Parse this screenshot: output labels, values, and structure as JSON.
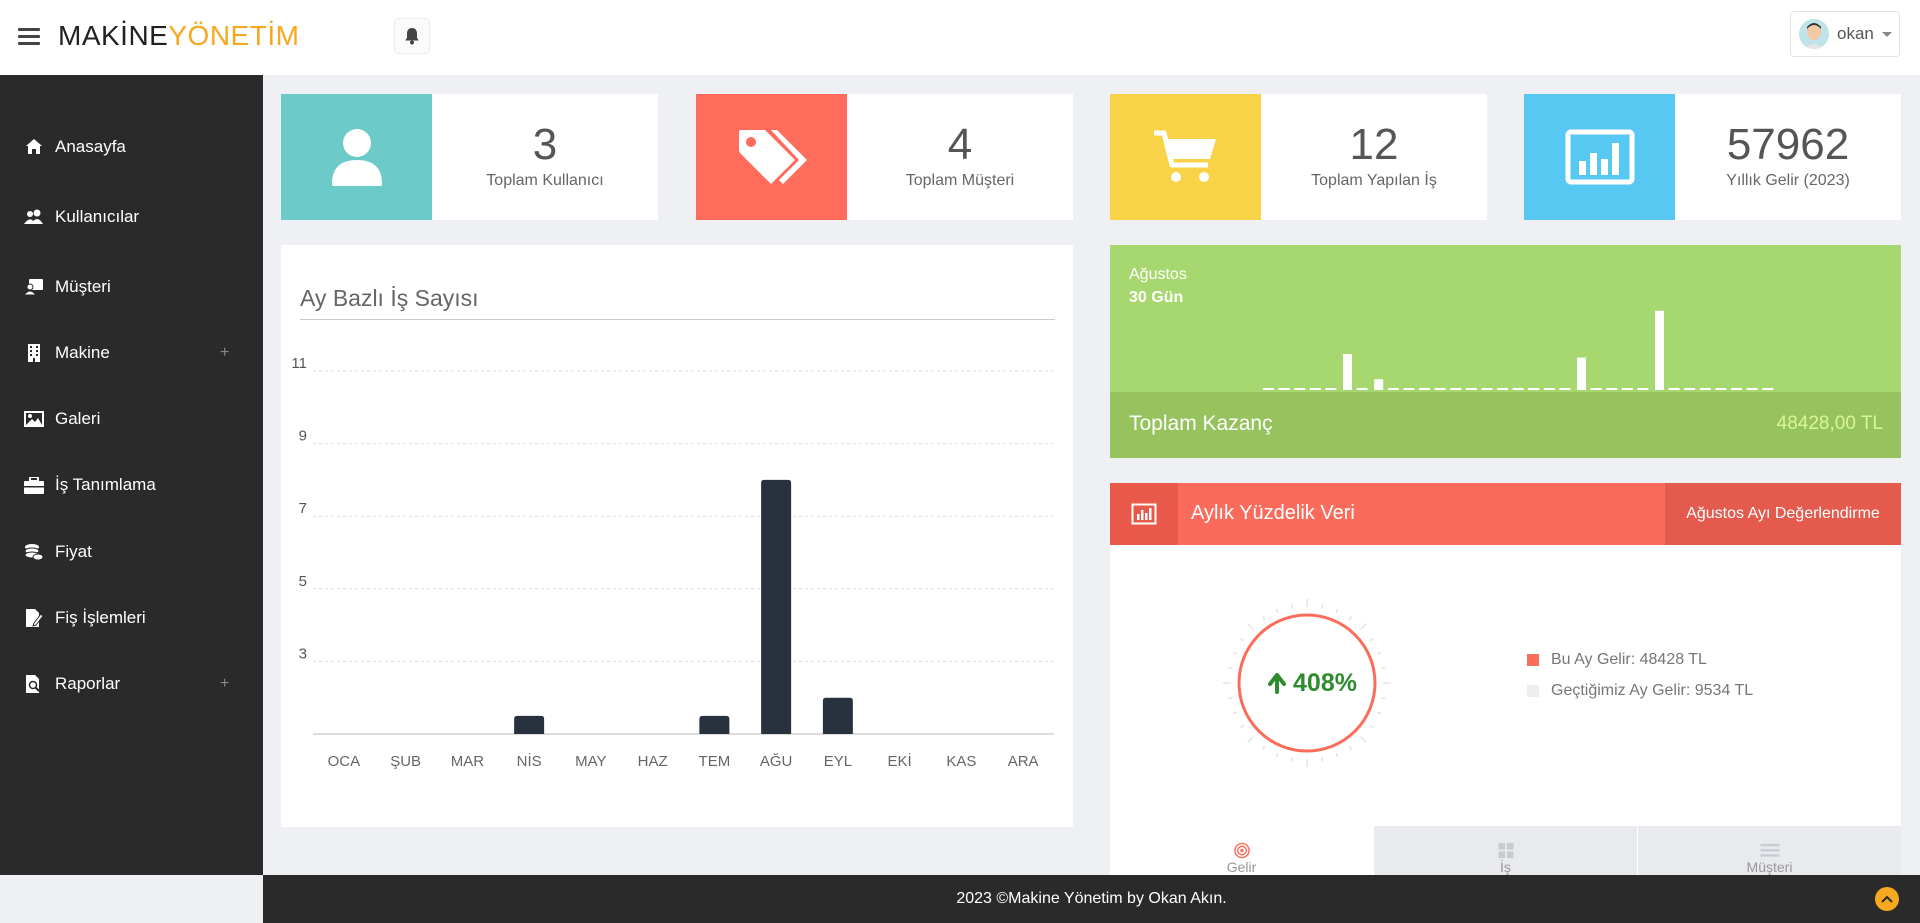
{
  "header": {
    "logo_part1": "MAKİNE",
    "logo_part2": "YÖNETİM",
    "user_name": "okan"
  },
  "sidebar": {
    "items": [
      {
        "label": "Anasayfa",
        "icon": "home-icon"
      },
      {
        "label": "Kullanıcılar",
        "icon": "users-icon"
      },
      {
        "label": "Müşteri",
        "icon": "customer-card-icon"
      },
      {
        "label": "Makine",
        "icon": "building-icon",
        "expandable": true
      },
      {
        "label": "Galeri",
        "icon": "image-icon"
      },
      {
        "label": "İş Tanımlama",
        "icon": "briefcase-icon"
      },
      {
        "label": "Fiyat",
        "icon": "coins-icon"
      },
      {
        "label": "Fiş İşlemleri",
        "icon": "edit-file-icon"
      },
      {
        "label": "Raporlar",
        "icon": "search-file-icon",
        "expandable": true
      }
    ],
    "expand_symbol": "+"
  },
  "stats": [
    {
      "value": "3",
      "caption": "Toplam Kullanıcı",
      "color": "#6ccac9",
      "icon": "user-icon"
    },
    {
      "value": "4",
      "caption": "Toplam Müşteri",
      "color": "#ff6c5c",
      "icon": "tags-icon"
    },
    {
      "value": "12",
      "caption": "Toplam Yapılan İş",
      "color": "#f8d347",
      "icon": "cart-icon"
    },
    {
      "value": "57962",
      "caption": "Yıllık Gelir (2023)",
      "color": "#57c8f2",
      "icon": "bar-chart-icon"
    }
  ],
  "chart_panel": {
    "title": "Ay Bazlı İş Sayısı"
  },
  "chart_data": {
    "type": "bar",
    "categories": [
      "OCA",
      "ŞUB",
      "MAR",
      "NİS",
      "MAY",
      "HAZ",
      "TEM",
      "AĞU",
      "EYL",
      "EKİ",
      "KAS",
      "ARA"
    ],
    "values": [
      0,
      0,
      0,
      0.5,
      0,
      0,
      0.5,
      7,
      1,
      0,
      0,
      0
    ],
    "y_ticks": [
      3,
      5,
      7,
      9,
      11
    ],
    "ylim": [
      1,
      11
    ],
    "grid": true,
    "bar_color": "#28323e"
  },
  "green_panel": {
    "month": "Ağustos",
    "days": "30 Gün",
    "total_label": "Toplam Kazanç",
    "total_value": "48428,00 TL",
    "daily_values": [
      0,
      0,
      0,
      0,
      0,
      5,
      0,
      1.5,
      0,
      0,
      0,
      0,
      0,
      0,
      0,
      0,
      0,
      0,
      0,
      0,
      4.5,
      0,
      0,
      0,
      0,
      11,
      0,
      0,
      0,
      0,
      0,
      0,
      0
    ]
  },
  "percent_panel": {
    "title": "Aylık Yüzdelik Veri",
    "button_label": "Ağustos Ayı Değerlendirme",
    "gauge_value": "408%",
    "legend": [
      {
        "label": "Bu Ay Gelir: 48428 TL",
        "color": "#fa6d5a"
      },
      {
        "label": "Geçtiğimiz Ay Gelir: 9534 TL",
        "color": "#eeeeee"
      }
    ],
    "tabs": [
      {
        "label": "Gelir",
        "icon": "target-icon"
      },
      {
        "label": "İş",
        "icon": "grid-icon"
      },
      {
        "label": "Müşteri",
        "icon": "list-icon"
      }
    ]
  },
  "footer": {
    "text": "2023 ©Makine Yönetim by Okan Akın."
  }
}
